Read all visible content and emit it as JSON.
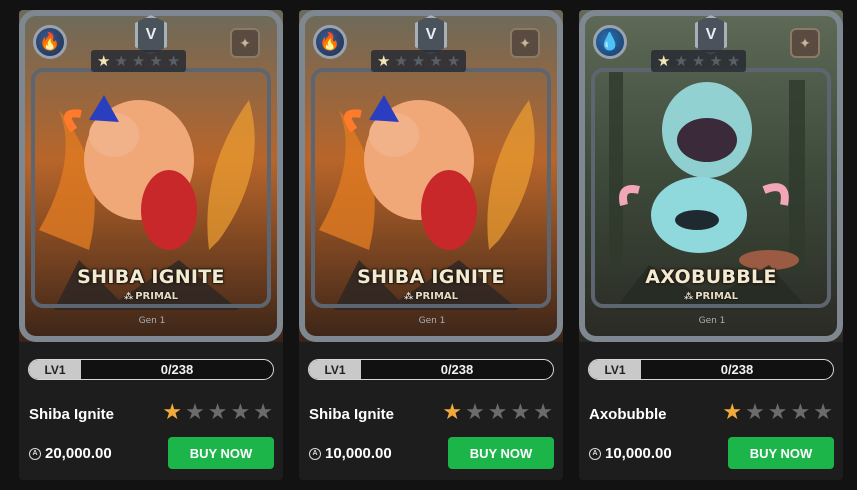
{
  "colors": {
    "buy_button": "#1bb54a",
    "star_on": "#f2a93b",
    "star_off": "#6b6b6b",
    "background": "#121212"
  },
  "cards": [
    {
      "art_title": "SHIBA IGNITE",
      "art_edition": "PRIMAL",
      "art_gen": "Gen 1",
      "element_icon": "fire-icon",
      "rarity_icon": "v-rarity-icon",
      "level": "LV1",
      "progress": "0/238",
      "name": "Shiba Ignite",
      "stars_filled": 1,
      "stars_total": 5,
      "price": "20,000.00",
      "buy_label": "BUY NOW"
    },
    {
      "art_title": "SHIBA IGNITE",
      "art_edition": "PRIMAL",
      "art_gen": "Gen 1",
      "element_icon": "fire-icon",
      "rarity_icon": "v-rarity-icon",
      "level": "LV1",
      "progress": "0/238",
      "name": "Shiba Ignite",
      "stars_filled": 1,
      "stars_total": 5,
      "price": "10,000.00",
      "buy_label": "BUY NOW"
    },
    {
      "art_title": "AXOBUBBLE",
      "art_edition": "PRIMAL",
      "art_gen": "Gen 1",
      "element_icon": "water-icon",
      "rarity_icon": "v-rarity-icon",
      "level": "LV1",
      "progress": "0/238",
      "name": "Axobubble",
      "stars_filled": 1,
      "stars_total": 5,
      "price": "10,000.00",
      "buy_label": "BUY NOW"
    }
  ]
}
